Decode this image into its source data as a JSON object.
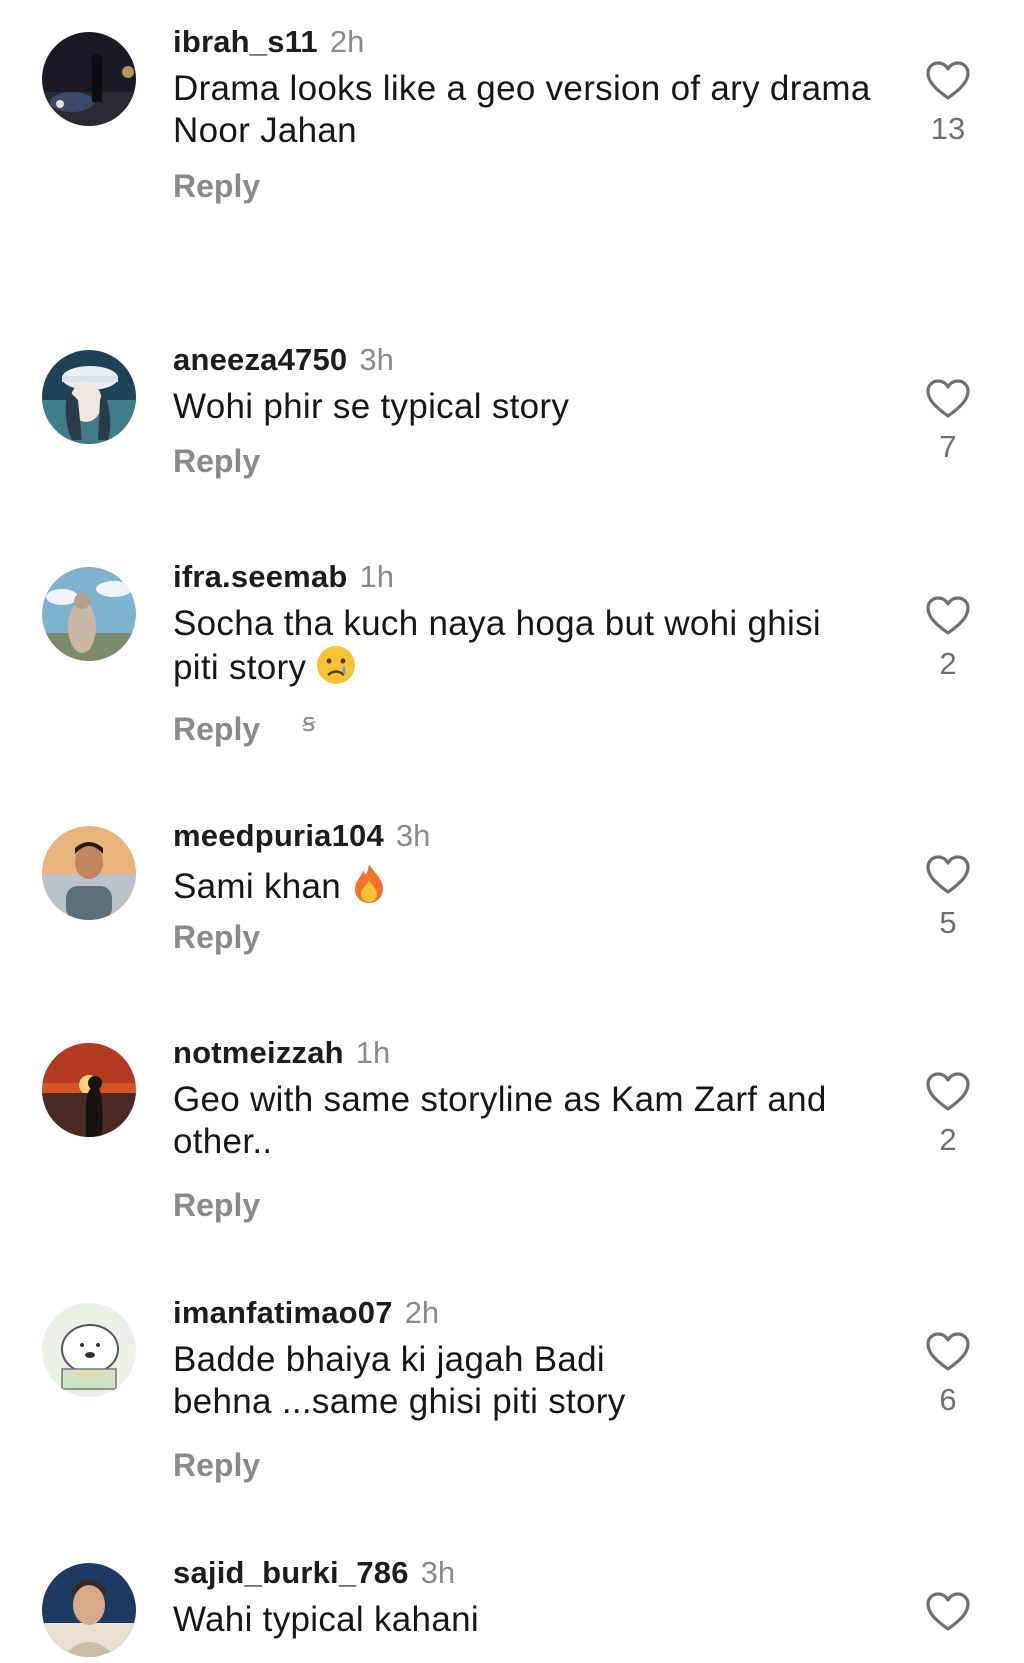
{
  "comments": [
    {
      "username": "ibrah_s11",
      "time": "2h",
      "text": "Drama looks like a geo version of ary drama Noor Jahan",
      "reply": "Reply",
      "likes": "13",
      "avatar": "avatar-car-night"
    },
    {
      "username": "aneeza4750",
      "time": "3h",
      "text": "Wohi phir se typical story",
      "reply": "Reply",
      "likes": "7",
      "avatar": "avatar-anime-girl-cap"
    },
    {
      "username": "ifra.seemab",
      "time": "1h",
      "text": "Socha tha kuch naya hoga but wohi ghisi piti story",
      "reply": "Reply",
      "likes": "2",
      "avatar": "avatar-girl-sky",
      "emoji": "crying-face"
    },
    {
      "username": "meedpuria104",
      "time": "3h",
      "text": "Sami khan",
      "reply": "Reply",
      "likes": "5",
      "avatar": "avatar-man-sunset",
      "emoji": "fire"
    },
    {
      "username": "notmeizzah",
      "time": "1h",
      "text": "Geo with same storyline as Kam Zarf and other..",
      "reply": "Reply",
      "likes": "2",
      "avatar": "avatar-sunset-silhouette"
    },
    {
      "username": "imanfatimao07",
      "time": "2h",
      "text": "Badde bhaiya ki jagah Badi behna ...same ghisi piti story",
      "reply": "Reply",
      "likes": "6",
      "avatar": "avatar-bear-sketch"
    },
    {
      "username": "sajid_burki_786",
      "time": "3h",
      "text": "Wahi typical kahani",
      "reply": "",
      "likes": "",
      "avatar": "avatar-man-blue"
    }
  ],
  "colors": {
    "accent_text": "#161616",
    "muted": "#8a8a8a",
    "heart_stroke": "#6f6f6f"
  }
}
